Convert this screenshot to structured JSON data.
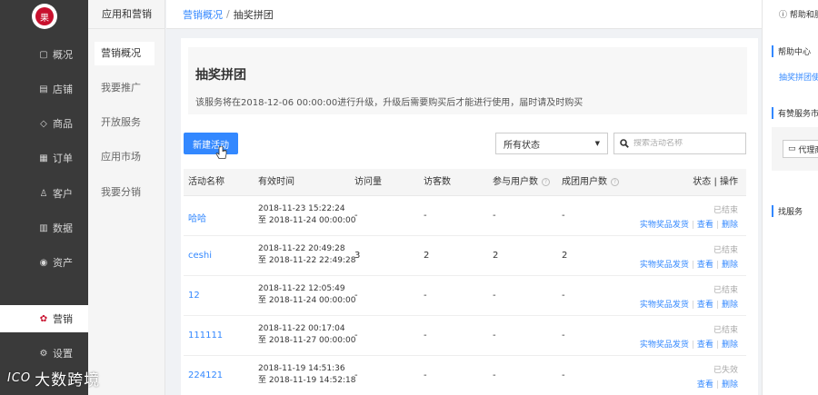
{
  "sidebar": {
    "logo_text": "果",
    "items": [
      {
        "icon": "monitor-icon",
        "glyph": "▢",
        "label": "概况"
      },
      {
        "icon": "store-icon",
        "glyph": "▤",
        "label": "店铺"
      },
      {
        "icon": "tag-icon",
        "glyph": "◇",
        "label": "商品"
      },
      {
        "icon": "order-icon",
        "glyph": "▦",
        "label": "订单"
      },
      {
        "icon": "customer-icon",
        "glyph": "♙",
        "label": "客户"
      },
      {
        "icon": "chart-icon",
        "glyph": "▥",
        "label": "数据"
      },
      {
        "icon": "asset-icon",
        "glyph": "◉",
        "label": "资产"
      },
      {
        "icon": "marketing-icon",
        "glyph": "✿",
        "label": "营销"
      },
      {
        "icon": "gear-icon",
        "glyph": "⚙",
        "label": "设置"
      }
    ]
  },
  "subnav": {
    "header": "应用和营销",
    "items": [
      "营销概况",
      "我要推广",
      "开放服务",
      "应用市场",
      "我要分销"
    ]
  },
  "breadcrumb": {
    "parent": "营销概况",
    "sep": "/",
    "current": "抽奖拼团"
  },
  "intro": {
    "title": "抽奖拼团",
    "desc": "该服务将在2018-12-06 00:00:00进行升级，升级后需要购买后才能进行使用，届时请及时购买"
  },
  "toolbar": {
    "new_label": "新建活动",
    "status_value": "所有状态",
    "search_placeholder": "搜索活动名称"
  },
  "table": {
    "headers": {
      "name": "活动名称",
      "time": "有效时间",
      "visits": "访问量",
      "visitors": "访客数",
      "participants": "参与用户数",
      "success": "成团用户数",
      "ops": "状态 | 操作"
    },
    "rows": [
      {
        "name": "哈哈",
        "start": "2018-11-23 15:22:24",
        "end": "至 2018-11-24 00:00:00",
        "visits": "-",
        "visitors": "-",
        "participants": "-",
        "success": "-",
        "status": "已结束",
        "ops": [
          "实物奖品发货",
          "查看",
          "删除"
        ]
      },
      {
        "name": "ceshi",
        "start": "2018-11-22 20:49:28",
        "end": "至 2018-11-22 22:49:28",
        "visits": "3",
        "visitors": "2",
        "participants": "2",
        "success": "2",
        "status": "已结束",
        "ops": [
          "实物奖品发货",
          "查看",
          "删除"
        ]
      },
      {
        "name": "12",
        "start": "2018-11-22 12:05:49",
        "end": "至 2018-11-24 00:00:00",
        "visits": "-",
        "visitors": "-",
        "participants": "-",
        "success": "-",
        "status": "已结束",
        "ops": [
          "实物奖品发货",
          "查看",
          "删除"
        ]
      },
      {
        "name": "111111",
        "start": "2018-11-22 00:17:04",
        "end": "至 2018-11-27 00:00:00",
        "visits": "-",
        "visitors": "-",
        "participants": "-",
        "success": "-",
        "status": "已结束",
        "ops": [
          "实物奖品发货",
          "查看",
          "删除"
        ]
      },
      {
        "name": "224121",
        "start": "2018-11-19 14:51:36",
        "end": "至 2018-11-19 14:52:18",
        "visits": "-",
        "visitors": "-",
        "participants": "-",
        "success": "-",
        "status": "已失效",
        "ops": [
          "查看",
          "删除"
        ]
      }
    ]
  },
  "help": {
    "top": "帮助和服务",
    "center": "帮助中心",
    "link": "抽奖拼团使用教程",
    "recommend": "有赞服务市场",
    "pill": "代理商",
    "service": "找服务"
  },
  "watermark": {
    "logo": "ICO",
    "text": "大数跨境"
  },
  "colors": {
    "accent": "#3388ff",
    "sidebar_bg": "#3a3a3a",
    "marketing_red": "#c8102e"
  }
}
